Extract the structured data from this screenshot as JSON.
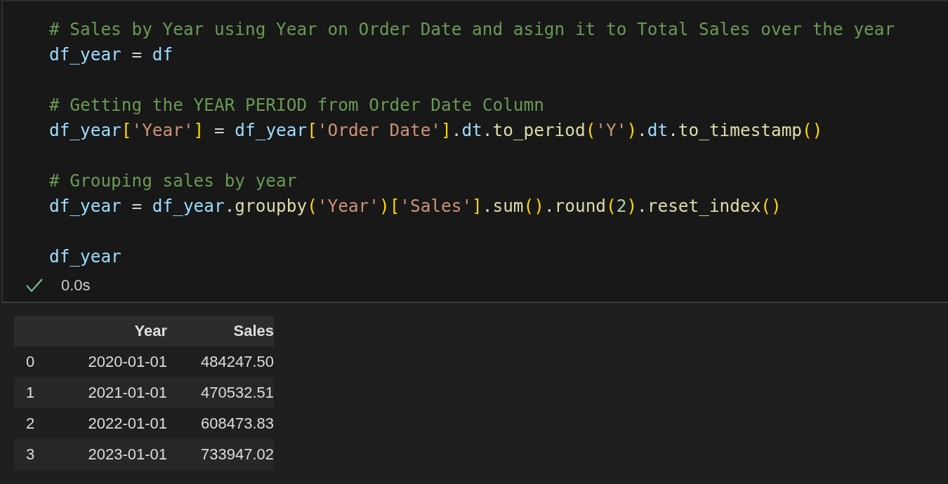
{
  "cell": {
    "blocks": [
      [
        {
          "tokens": [
            {
              "kind": "comment",
              "text": "# Sales by Year using Year on Order Date and asign it to Total Sales over the year"
            }
          ]
        },
        {
          "tokens": [
            {
              "kind": "var",
              "text": "df_year"
            },
            {
              "kind": "plain",
              "text": " = "
            },
            {
              "kind": "var",
              "text": "df"
            }
          ]
        }
      ],
      [
        {
          "tokens": [
            {
              "kind": "comment",
              "text": "# Getting the YEAR PERIOD from Order Date Column"
            }
          ]
        },
        {
          "tokens": [
            {
              "kind": "var",
              "text": "df_year"
            },
            {
              "kind": "bracket",
              "text": "["
            },
            {
              "kind": "str",
              "text": "'Year'"
            },
            {
              "kind": "bracket",
              "text": "]"
            },
            {
              "kind": "plain",
              "text": " = "
            },
            {
              "kind": "var",
              "text": "df_year"
            },
            {
              "kind": "bracket",
              "text": "["
            },
            {
              "kind": "str",
              "text": "'Order Date'"
            },
            {
              "kind": "bracket",
              "text": "]"
            },
            {
              "kind": "plain",
              "text": "."
            },
            {
              "kind": "var",
              "text": "dt"
            },
            {
              "kind": "plain",
              "text": "."
            },
            {
              "kind": "func",
              "text": "to_period"
            },
            {
              "kind": "bracket",
              "text": "("
            },
            {
              "kind": "str",
              "text": "'Y'"
            },
            {
              "kind": "bracket",
              "text": ")"
            },
            {
              "kind": "plain",
              "text": "."
            },
            {
              "kind": "var",
              "text": "dt"
            },
            {
              "kind": "plain",
              "text": "."
            },
            {
              "kind": "func",
              "text": "to_timestamp"
            },
            {
              "kind": "bracket",
              "text": "()"
            }
          ]
        }
      ],
      [
        {
          "tokens": [
            {
              "kind": "comment",
              "text": "# Grouping sales by year"
            }
          ]
        },
        {
          "tokens": [
            {
              "kind": "var",
              "text": "df_year"
            },
            {
              "kind": "plain",
              "text": " = "
            },
            {
              "kind": "var",
              "text": "df_year"
            },
            {
              "kind": "plain",
              "text": "."
            },
            {
              "kind": "func",
              "text": "groupby"
            },
            {
              "kind": "bracket",
              "text": "("
            },
            {
              "kind": "str",
              "text": "'Year'"
            },
            {
              "kind": "bracket",
              "text": ")"
            },
            {
              "kind": "bracket",
              "text": "["
            },
            {
              "kind": "str",
              "text": "'Sales'"
            },
            {
              "kind": "bracket",
              "text": "]"
            },
            {
              "kind": "plain",
              "text": "."
            },
            {
              "kind": "func",
              "text": "sum"
            },
            {
              "kind": "bracket",
              "text": "()"
            },
            {
              "kind": "plain",
              "text": "."
            },
            {
              "kind": "func",
              "text": "round"
            },
            {
              "kind": "bracket",
              "text": "("
            },
            {
              "kind": "num",
              "text": "2"
            },
            {
              "kind": "bracket",
              "text": ")"
            },
            {
              "kind": "plain",
              "text": "."
            },
            {
              "kind": "func",
              "text": "reset_index"
            },
            {
              "kind": "bracket",
              "text": "()"
            }
          ]
        }
      ],
      [
        {
          "tokens": [
            {
              "kind": "var",
              "text": "df_year"
            }
          ]
        }
      ]
    ],
    "status": {
      "succeeded": true,
      "duration": "0.0s"
    }
  },
  "output": {
    "table": {
      "columns": [
        "Year",
        "Sales"
      ],
      "rows": [
        {
          "index": "0",
          "cells": [
            "2020-01-01",
            "484247.50"
          ]
        },
        {
          "index": "1",
          "cells": [
            "2021-01-01",
            "470532.51"
          ]
        },
        {
          "index": "2",
          "cells": [
            "2022-01-01",
            "608473.83"
          ]
        },
        {
          "index": "3",
          "cells": [
            "2023-01-01",
            "733947.02"
          ]
        }
      ]
    }
  }
}
